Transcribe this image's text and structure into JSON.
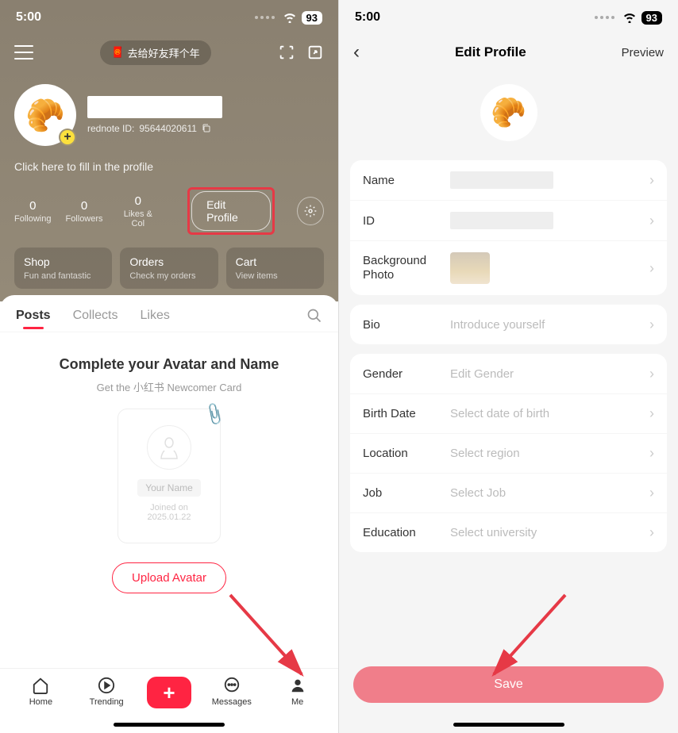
{
  "status": {
    "time": "5:00",
    "battery": "93"
  },
  "left": {
    "promo_text": "去给好友拜个年",
    "id_label": "rednote ID:",
    "id_value": "95644020611",
    "profile_hint": "Click here to fill in the profile",
    "stats": [
      {
        "num": "0",
        "label": "Following"
      },
      {
        "num": "0",
        "label": "Followers"
      },
      {
        "num": "0",
        "label": "Likes & Col"
      }
    ],
    "edit_btn": "Edit Profile",
    "cards": [
      {
        "title": "Shop",
        "sub": "Fun and fantastic"
      },
      {
        "title": "Orders",
        "sub": "Check my orders"
      },
      {
        "title": "Cart",
        "sub": "View items"
      }
    ],
    "tabs": [
      "Posts",
      "Collects",
      "Likes"
    ],
    "complete_title": "Complete your Avatar and Name",
    "complete_sub": "Get the 小红书 Newcomer Card",
    "newcomer_name": "Your Name",
    "newcomer_date": "Joined on 2025.01.22",
    "upload_btn": "Upload Avatar",
    "nav": [
      "Home",
      "Trending",
      "Messages",
      "Me"
    ]
  },
  "right": {
    "title": "Edit Profile",
    "preview": "Preview",
    "fields": {
      "name": "Name",
      "id": "ID",
      "bg_photo": "Background Photo",
      "bio": "Bio",
      "bio_placeholder": "Introduce yourself",
      "gender": "Gender",
      "gender_placeholder": "Edit Gender",
      "birth": "Birth Date",
      "birth_placeholder": "Select date of birth",
      "location": "Location",
      "location_placeholder": "Select region",
      "job": "Job",
      "job_placeholder": "Select Job",
      "education": "Education",
      "education_placeholder": "Select university"
    },
    "save": "Save"
  }
}
